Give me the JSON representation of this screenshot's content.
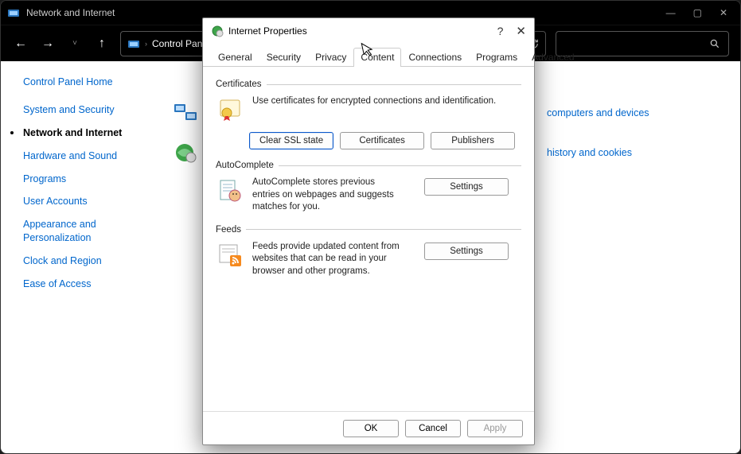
{
  "window": {
    "title": "Network and Internet"
  },
  "nav": {
    "breadcrumb": [
      "Control Panel"
    ]
  },
  "sidebar": {
    "items": [
      {
        "label": "Control Panel Home"
      },
      {
        "label": "System and Security"
      },
      {
        "label": "Network and Internet",
        "active": true
      },
      {
        "label": "Hardware and Sound"
      },
      {
        "label": "Programs"
      },
      {
        "label": "User Accounts"
      },
      {
        "label": "Appearance and Personalization"
      },
      {
        "label": "Clock and Region"
      },
      {
        "label": "Ease of Access"
      }
    ]
  },
  "main_bg": {
    "link1": "computers and devices",
    "link2": "history and cookies"
  },
  "dialog": {
    "title": "Internet Properties",
    "tabs": [
      "General",
      "Security",
      "Privacy",
      "Content",
      "Connections",
      "Programs",
      "Advanced"
    ],
    "active_tab": "Content",
    "certificates": {
      "label": "Certificates",
      "desc": "Use certificates for encrypted connections and identification.",
      "buttons": {
        "clear": "Clear SSL state",
        "certs": "Certificates",
        "pubs": "Publishers"
      }
    },
    "autocomplete": {
      "label": "AutoComplete",
      "desc": "AutoComplete stores previous entries on webpages and suggests matches for you.",
      "button": "Settings"
    },
    "feeds": {
      "label": "Feeds",
      "desc": "Feeds provide updated content from websites that can be read in your browser and other programs.",
      "button": "Settings"
    },
    "footer": {
      "ok": "OK",
      "cancel": "Cancel",
      "apply": "Apply"
    }
  }
}
